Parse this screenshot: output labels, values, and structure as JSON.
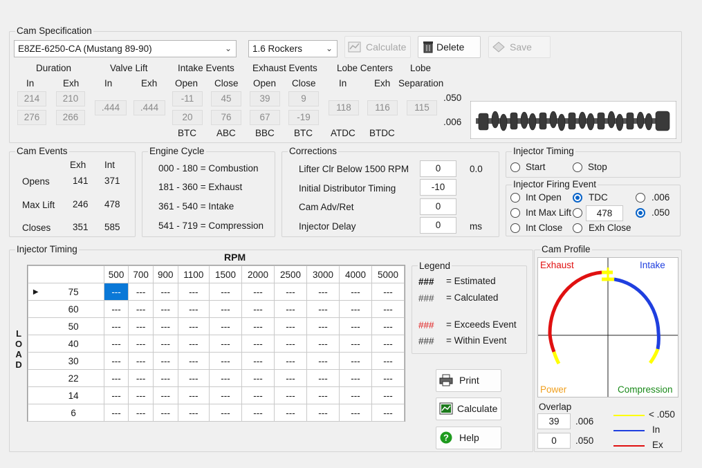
{
  "cam_spec": {
    "group_label": "Cam Specification",
    "selected_cam": "E8ZE-6250-CA (Mustang 89-90)",
    "rockers": "1.6 Rockers",
    "buttons": {
      "calculate": "Calculate",
      "delete": "Delete",
      "save": "Save"
    },
    "headers": {
      "duration": "Duration",
      "valve_lift": "Valve Lift",
      "intake_events": "Intake Events",
      "exhaust_events": "Exhaust Events",
      "lobe_centers": "Lobe Centers",
      "lobe": "Lobe",
      "separation": "Separation",
      "in": "In",
      "exh": "Exh",
      "open": "Open",
      "close": "Close"
    },
    "duration": {
      "in_050": "214",
      "exh_050": "210",
      "in_006": "276",
      "exh_006": "266"
    },
    "valve_lift": {
      "in": ".444",
      "exh": ".444"
    },
    "intake_events": {
      "open_050": "-11",
      "close_050": "45",
      "open_006": "20",
      "close_006": "76"
    },
    "exhaust_events": {
      "open_050": "39",
      "close_050": "9",
      "open_006": "67",
      "close_006": "-19"
    },
    "lobe_centers": {
      "in": "118",
      "exh": "116"
    },
    "lobe_separation": "115",
    "row_labels": {
      "r050": ".050",
      "r006": ".006"
    },
    "footer": {
      "btc1": "BTC",
      "abc": "ABC",
      "bbc": "BBC",
      "btc2": "BTC",
      "atdc": "ATDC",
      "btdc": "BTDC"
    }
  },
  "cam_events": {
    "group_label": "Cam Events",
    "col_exh": "Exh",
    "col_int": "Int",
    "rows": [
      {
        "label": "Opens",
        "exh": "141",
        "int": "371"
      },
      {
        "label": "Max Lift",
        "exh": "246",
        "int": "478"
      },
      {
        "label": "Closes",
        "exh": "351",
        "int": "585"
      }
    ]
  },
  "engine_cycle": {
    "group_label": "Engine Cycle",
    "lines": [
      "000 - 180 = Combustion",
      "181 - 360 = Exhaust",
      "361 - 540 = Intake",
      "541 - 719 = Compression"
    ]
  },
  "corrections": {
    "group_label": "Corrections",
    "lifter_label": "Lifter Clr Below 1500 RPM",
    "lifter_value": "0",
    "lifter_extra": "0.0",
    "timing_label": "Initial Distributor Timing",
    "timing_value": "-10",
    "advret_label": "Cam Adv/Ret",
    "advret_value": "0",
    "injdelay_label": "Injector Delay",
    "injdelay_value": "0",
    "injdelay_unit": "ms"
  },
  "injector_timing_top": {
    "group_label": "Injector  Timing",
    "start": "Start",
    "stop": "Stop"
  },
  "injector_firing": {
    "group_label": "Injector Firing Event",
    "int_open": "Int Open",
    "tdc": "TDC",
    "opt_006": ".006",
    "int_max_lift": "Int Max Lift",
    "custom_value": "478",
    "opt_050": ".050",
    "int_close": "Int Close",
    "exh_close": "Exh Close"
  },
  "injector_grid": {
    "group_label": "Injector Timing",
    "rpm_label": "RPM",
    "load_label": [
      "L",
      "O",
      "A",
      "D"
    ],
    "rpm": [
      "500",
      "700",
      "900",
      "1100",
      "1500",
      "2000",
      "2500",
      "3000",
      "4000",
      "5000"
    ],
    "load": [
      "75",
      "60",
      "50",
      "40",
      "30",
      "22",
      "14",
      "6"
    ],
    "cell": "---",
    "row_marker": "▶"
  },
  "legend": {
    "group_label": "Legend",
    "items": [
      {
        "mark": "###",
        "text": "= Estimated",
        "color": "#111111"
      },
      {
        "mark": "###",
        "text": "= Calculated",
        "color": "#4a4a4a"
      },
      {
        "mark": "###",
        "text": "= Exceeds Event",
        "color": "#e02020"
      },
      {
        "mark": "###",
        "text": "=  Within Event",
        "color": "#333333"
      }
    ]
  },
  "actions": {
    "print": "Print",
    "calculate": "Calculate",
    "help": "Help"
  },
  "cam_profile": {
    "group_label": "Cam Profile",
    "exhaust": "Exhaust",
    "intake": "Intake",
    "power": "Power",
    "compression": "Compression",
    "overlap_label": "Overlap",
    "overlap_006": "39",
    "overlap_006_label": ".006",
    "overlap_050": "0",
    "overlap_050_label": ".050",
    "key": [
      {
        "text": "< .050",
        "color": "#ffff00"
      },
      {
        "text": "In",
        "color": "#1f3fdf"
      },
      {
        "text": "Ex",
        "color": "#e01010"
      }
    ],
    "colors": {
      "exhaust": "#e01010",
      "intake": "#1f3fdf",
      "marker": "#ffff00"
    }
  }
}
